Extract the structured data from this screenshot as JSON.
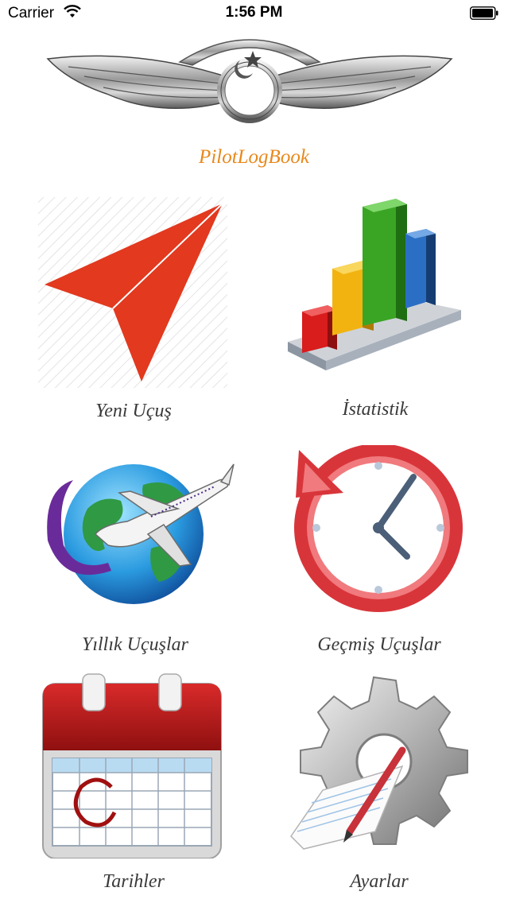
{
  "status_bar": {
    "carrier": "Carrier",
    "time": "1:56 PM",
    "wifi_icon": "wifi-icon",
    "battery_icon": "battery-icon"
  },
  "app": {
    "title": "PilotLogBook",
    "title_color": "#e8881c",
    "logo_icon": "pilot-wings-icon"
  },
  "menu": [
    {
      "id": "new-flight",
      "label": "Yeni Uçuş",
      "icon": "paper-plane-icon"
    },
    {
      "id": "statistics",
      "label": "İstatistik",
      "icon": "bar-chart-icon"
    },
    {
      "id": "yearly-flights",
      "label": "Yıllık Uçuşlar",
      "icon": "globe-airplane-icon"
    },
    {
      "id": "past-flights",
      "label": "Geçmiş Uçuşlar",
      "icon": "history-clock-icon"
    },
    {
      "id": "dates",
      "label": "Tarihler",
      "icon": "calendar-icon"
    },
    {
      "id": "settings",
      "label": "Ayarlar",
      "icon": "settings-gear-icon"
    }
  ]
}
